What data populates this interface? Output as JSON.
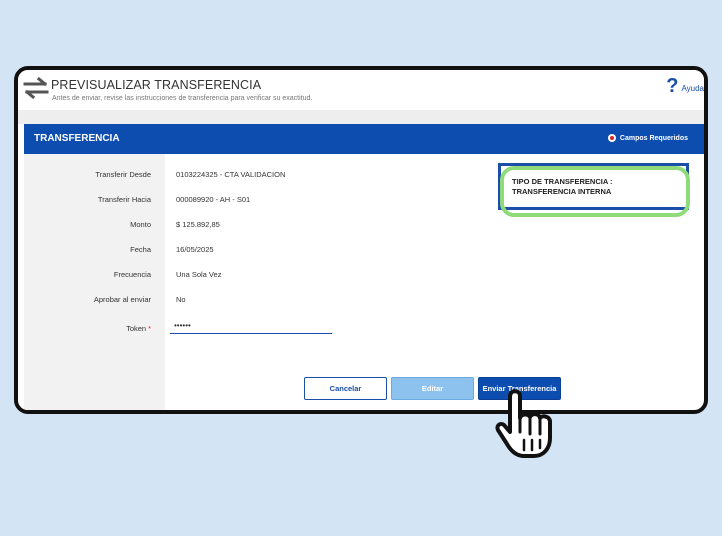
{
  "header": {
    "title": "PREVISUALIZAR TRANSFERENCIA",
    "subtitle": "Antes de enviar, revise las instrucciones de transferencia para verificar su exactitud.",
    "help_label": "Ayuda",
    "help_icon": "question-mark-icon",
    "title_icon": "swap-arrows-icon"
  },
  "card": {
    "title": "TRANSFERENCIA",
    "required_legend": "Campos Requeridos"
  },
  "fields": [
    {
      "label": "Transferir Desde",
      "value": "0103224325 - CTA VALIDACION"
    },
    {
      "label": "Transferir Hacia",
      "value": "000089920 - AH - S01"
    },
    {
      "label": "Monto",
      "value": "$ 125.892,85"
    },
    {
      "label": "Fecha",
      "value": "16/05/2025"
    },
    {
      "label": "Frecuencia",
      "value": "Una Sola Vez"
    },
    {
      "label": "Aprobar al enviar",
      "value": "No"
    }
  ],
  "token": {
    "label": "Token",
    "required_mark": "*",
    "value": "••••••"
  },
  "transfer_type": {
    "text": "TIPO DE TRANSFERENCIA : TRANSFERENCIA INTERNA"
  },
  "buttons": {
    "cancel": "Cancelar",
    "edit": "Editar",
    "send": "Enviar Transferencia"
  },
  "colors": {
    "background": "#d3e4f5",
    "primary_blue": "#0d4db0",
    "light_blue_button": "#8ec2ee",
    "highlight_green": "#8fdb7a",
    "required_red": "#d9232d"
  }
}
